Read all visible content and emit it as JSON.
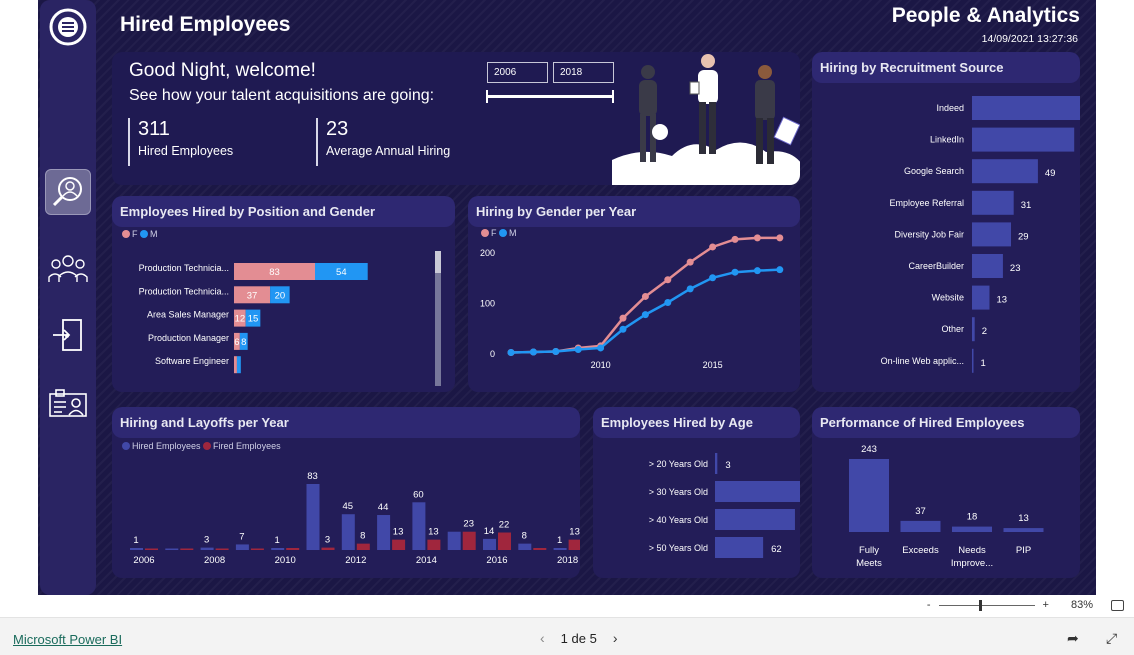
{
  "report": {
    "title": "Hired Employees",
    "brand": "People & Analytics",
    "timestamp": "14/09/2021 13:27:36"
  },
  "nav": {
    "items": [
      "logo-icon",
      "search-person-icon",
      "team-icon",
      "exit-door-icon",
      "id-card-icon"
    ]
  },
  "hero": {
    "greeting": "Good Night, welcome!",
    "subtitle": "See how your talent acquisitions are going:",
    "kpis": [
      {
        "value": "311",
        "label": "Hired Employees"
      },
      {
        "value": "23",
        "label": "Average Annual Hiring"
      }
    ],
    "year_from": "2006",
    "year_to": "2018"
  },
  "colors": {
    "female": "#e38d93",
    "male": "#2196f3",
    "bar": "#4148a8",
    "fired": "#a0263d",
    "bg": "#1b1745"
  },
  "chart_data": [
    {
      "type": "bar",
      "title": "Employees Hired by Position and Gender",
      "legend": [
        "F",
        "M"
      ],
      "categories": [
        "Production Technicia...",
        "Production Technicia...",
        "Area Sales Manager",
        "Production Manager",
        "Software Engineer"
      ],
      "series": [
        {
          "name": "F",
          "values": [
            83,
            37,
            12,
            6,
            3
          ]
        },
        {
          "name": "M",
          "values": [
            54,
            20,
            15,
            8,
            4
          ]
        }
      ]
    },
    {
      "type": "line",
      "title": "Hiring by Gender per Year",
      "legend": [
        "F",
        "M"
      ],
      "x": [
        2006,
        2007,
        2008,
        2009,
        2010,
        2011,
        2012,
        2013,
        2014,
        2015,
        2016,
        2017,
        2018
      ],
      "series": [
        {
          "name": "F",
          "values": [
            1,
            2,
            3,
            10,
            14,
            69,
            112,
            145,
            180,
            210,
            225,
            228,
            228
          ]
        },
        {
          "name": "M",
          "values": [
            1,
            2,
            3,
            7,
            10,
            47,
            76,
            100,
            127,
            149,
            160,
            163,
            165
          ]
        }
      ],
      "yticks": [
        "0",
        "100",
        "200"
      ],
      "xticks": [
        "2010",
        "2015"
      ],
      "ylim": [
        0,
        250
      ]
    },
    {
      "type": "bar",
      "title": "Hiring by Recruitment Source",
      "categories": [
        "Indeed",
        "LinkedIn",
        "Google Search",
        "Employee Referral",
        "Diversity Job Fair",
        "CareerBuilder",
        "Website",
        "Other",
        "On-line Web applic..."
      ],
      "values": [
        87,
        76,
        49,
        31,
        29,
        23,
        13,
        2,
        1
      ]
    },
    {
      "type": "bar",
      "title": "Hiring and Layoffs per Year",
      "legend": [
        "Hired Employees",
        "Fired Employees"
      ],
      "x": [
        "2006",
        "2007",
        "2008",
        "2009",
        "2010",
        "2011",
        "2012",
        "2013",
        "2014",
        "2015",
        "2016",
        "2017",
        "2018"
      ],
      "xticks": [
        "2006",
        "2008",
        "2010",
        "2012",
        "2014",
        "2016",
        "2018"
      ],
      "series": [
        {
          "name": "Hired Employees",
          "values": [
            1,
            0,
            3,
            7,
            1,
            83,
            45,
            44,
            60,
            23,
            14,
            8,
            1
          ]
        },
        {
          "name": "Fired Employees",
          "values": [
            0,
            0,
            0,
            0,
            1,
            3,
            8,
            13,
            13,
            23,
            22,
            1,
            13
          ]
        }
      ],
      "labels": {
        "hired": [
          "1",
          "",
          "3",
          "7",
          "1",
          "83",
          "45",
          "44",
          "60",
          "",
          "14",
          "8",
          "1"
        ],
        "fired": [
          "",
          "",
          "",
          "",
          "",
          "3",
          "8",
          "13",
          "13",
          "23",
          "22",
          "",
          "13"
        ]
      }
    },
    {
      "type": "bar",
      "title": "Employees Hired by Age",
      "categories": [
        "> 20 Years Old",
        "> 30 Years Old",
        "> 40 Years Old",
        "> 50 Years Old"
      ],
      "values": [
        3,
        143,
        103,
        62
      ]
    },
    {
      "type": "bar",
      "title": "Performance of Hired Employees",
      "categories": [
        "Fully Meets",
        "Exceeds",
        "Needs Improve...",
        "PIP"
      ],
      "values": [
        243,
        37,
        18,
        13
      ]
    }
  ],
  "footer": {
    "powerbi": "Microsoft Power BI",
    "page": "1 de 5",
    "zoom": "83%",
    "zoom_minus": "-",
    "zoom_plus": "+"
  }
}
